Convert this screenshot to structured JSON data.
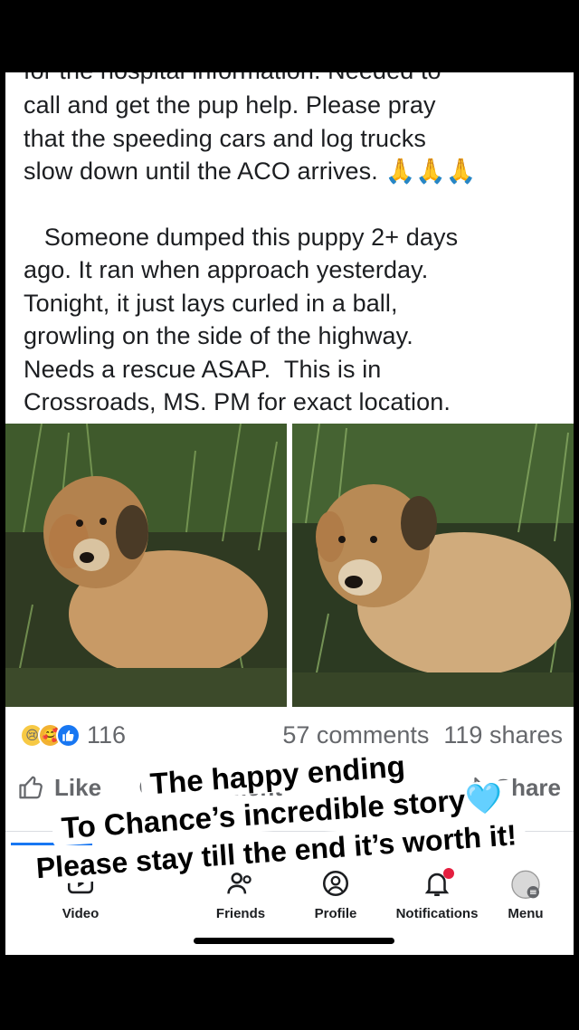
{
  "post": {
    "cut_text": "for the hospital information. Needed to",
    "line1": "call and get the pup help. Please pray",
    "line2": "that the speeding cars and log trucks",
    "line3": "slow down until the ACO arrives. 🙏🙏🙏",
    "para2": [
      "   Someone dumped this puppy 2+ days",
      "ago. It ran when approach yesterday.",
      "Tonight, it just lays curled in a ball,",
      "growling on the side of the highway.",
      "Needs a rescue ASAP.  This is in",
      "Crossroads, MS. PM for exact location."
    ]
  },
  "stats": {
    "reaction_count": "116",
    "comments": "57 comments",
    "shares": "119 shares"
  },
  "actions": {
    "like": "Like",
    "comment": "Comment",
    "share": "Share"
  },
  "tabs": {
    "video": "Video",
    "friends": "Friends",
    "profile": "Profile",
    "notifications": "Notifications",
    "menu": "Menu"
  },
  "caption": {
    "line1": "The happy ending",
    "line2": "To Chance’s incredible story🩵",
    "line3": "Please stay till the end it’s worth it!"
  },
  "colors": {
    "accent": "#1877f2",
    "text": "#1c1e21",
    "muted": "#65676b",
    "notification_badge": "#e41e3f"
  }
}
